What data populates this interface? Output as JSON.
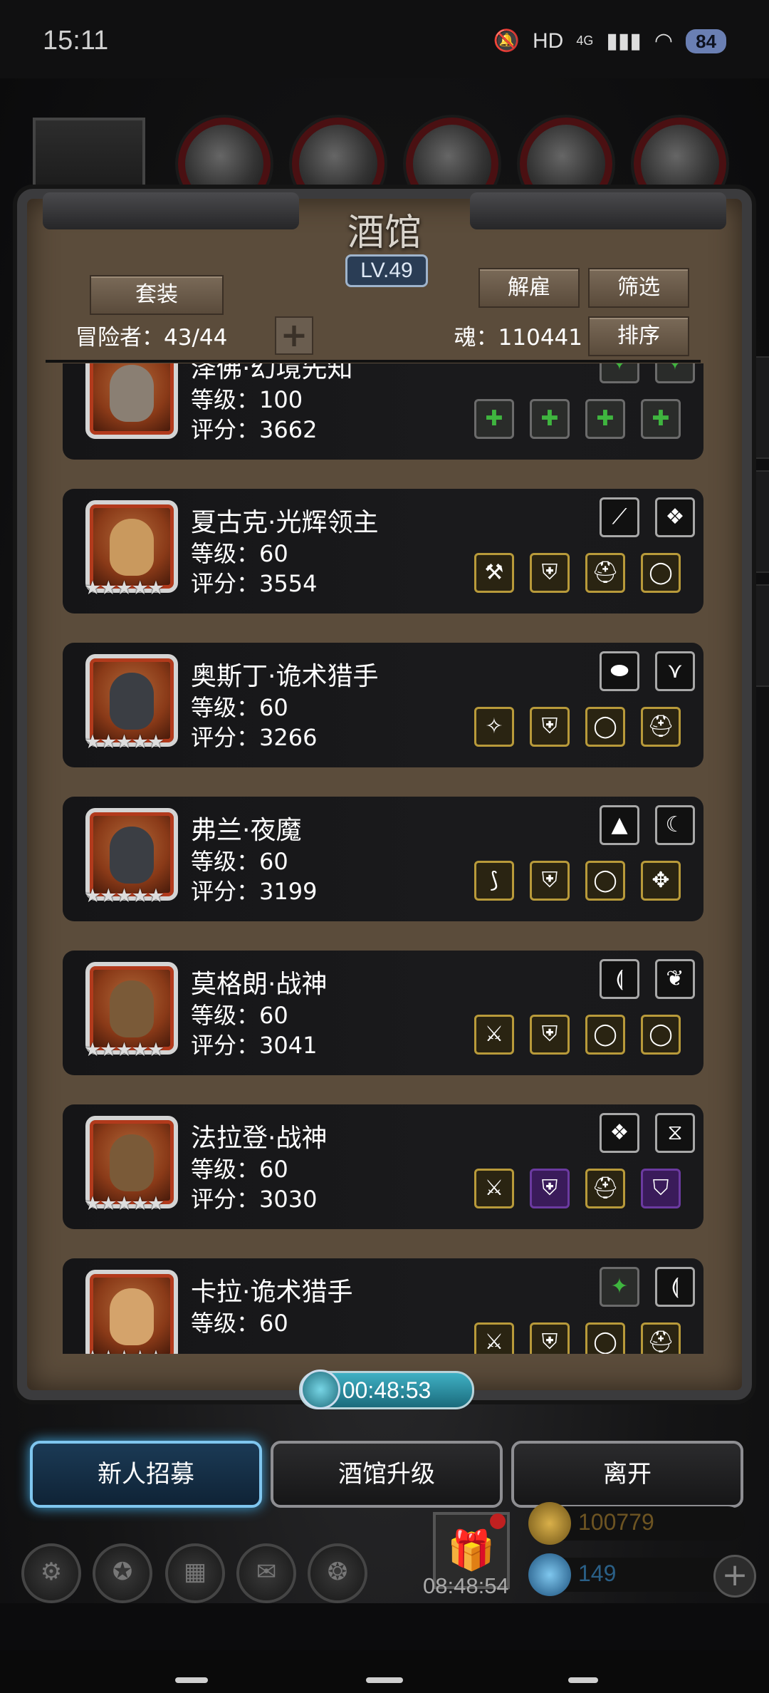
{
  "status_bar": {
    "time": "15:11",
    "network": "4G",
    "hd": "HD",
    "battery": "84"
  },
  "panel": {
    "title": "酒馆",
    "level": "LV.49",
    "outfit_button": "套装",
    "dismiss_button": "解雇",
    "filter_button": "筛选",
    "sort_button": "排序",
    "adventurers": "冒险者：43/44",
    "soul": "魂：110441"
  },
  "heroes": [
    {
      "name": "泽佛·幻境先知",
      "level": "等级：100",
      "score": "评分：3662",
      "stars": "",
      "equip_top": [
        "gem-slot-icon",
        "gem-slot-icon"
      ],
      "equip_bottom": [
        "syringe-icon",
        "plus-icon",
        "plus-circle-icon",
        "plus-circle-icon"
      ]
    },
    {
      "name": "夏古克·光辉领主",
      "level": "等级：60",
      "score": "评分：3554",
      "stars": "★★★★★",
      "equip_top": [
        "dagger-icon",
        "crystal-icon"
      ],
      "equip_bottom": [
        "axe-icon",
        "armor-icon",
        "helmet-icon",
        "ring-icon"
      ]
    },
    {
      "name": "奥斯丁·诡术猎手",
      "level": "等级：60",
      "score": "评分：3266",
      "stars": "★★★★★",
      "equip_top": [
        "gem-icon",
        "claw-icon"
      ],
      "equip_bottom": [
        "staff-icon",
        "armor-icon",
        "ring-icon",
        "helmet-icon"
      ]
    },
    {
      "name": "弗兰·夜魔",
      "level": "等级：60",
      "score": "评分：3199",
      "stars": "★★★★★",
      "equip_top": [
        "hood-icon",
        "horn-icon"
      ],
      "equip_bottom": [
        "scimitar-icon",
        "armor-icon",
        "ring-icon",
        "amulet-icon"
      ]
    },
    {
      "name": "莫格朗·战神",
      "level": "等级：60",
      "score": "评分：3041",
      "stars": "★★★★★",
      "equip_top": [
        "bow-icon",
        "feather-icon"
      ],
      "equip_bottom": [
        "battle-axe-icon",
        "armor-icon",
        "ring-icon",
        "ring-icon"
      ]
    },
    {
      "name": "法拉登·战神",
      "level": "等级：60",
      "score": "评分：3030",
      "stars": "★★★★★",
      "equip_top": [
        "crystal-icon",
        "scroll-icon"
      ],
      "equip_bottom": [
        "battle-axe-icon",
        "armor-icon",
        "helmet-icon",
        "shield-icon"
      ]
    },
    {
      "name": "卡拉·诡术猎手",
      "level": "等级：60",
      "score": "",
      "stars": "★★★★★",
      "equip_top": [
        "gem-slot-icon",
        "bow-icon"
      ],
      "equip_bottom": [
        "weapon-icon",
        "armor-icon",
        "ring-icon",
        "helmet-icon"
      ]
    }
  ],
  "timer": "00:48:53",
  "actions": {
    "recruit": "新人招募",
    "upgrade": "酒馆升级",
    "leave": "离开"
  },
  "hud": {
    "gold": "100779",
    "gems": "149",
    "gift_timer": "08:48:54"
  },
  "colors": {
    "panel": "#5b4c3b",
    "recruit_glow": "#3fa2d8",
    "timer": "#3fb0c4"
  }
}
